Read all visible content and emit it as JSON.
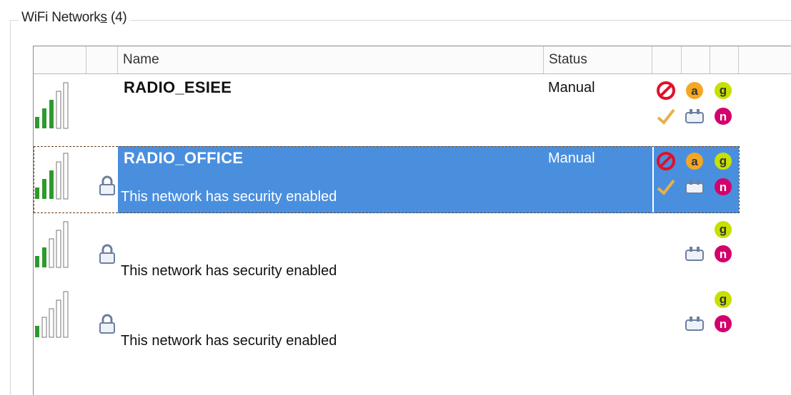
{
  "group": {
    "title_pre": "WiFi Network",
    "title_u": "s",
    "title_post": " (4)"
  },
  "columns": {
    "name": "Name",
    "status": "Status"
  },
  "networks": [
    {
      "name": "RADIO_ESIEE",
      "status": "Manual",
      "security": "",
      "signal_bars": 3,
      "locked": false,
      "selected": false,
      "icons": [
        "blocked-icon",
        "band-a-icon",
        "band-g-icon",
        "check-icon",
        "adapter-icon",
        "band-n-icon"
      ]
    },
    {
      "name": "RADIO_OFFICE",
      "status": "Manual",
      "security": "This network has security enabled",
      "signal_bars": 3,
      "locked": true,
      "selected": true,
      "icons": [
        "blocked-icon",
        "band-a-icon",
        "band-g-icon",
        "check-icon",
        "adapter-icon",
        "band-n-icon"
      ]
    },
    {
      "name": "",
      "status": "",
      "security": "This network has security enabled",
      "signal_bars": 2,
      "locked": true,
      "selected": false,
      "icons": [
        "band-g-icon",
        "adapter-icon",
        "band-n-icon"
      ]
    },
    {
      "name": "",
      "status": "",
      "security": "This network has security enabled",
      "signal_bars": 1,
      "locked": true,
      "selected": false,
      "icons": [
        "band-g-icon",
        "adapter-icon",
        "band-n-icon"
      ]
    }
  ],
  "colors": {
    "selection": "#4a8fde",
    "signal_on": "#2e9a2e",
    "band_a": "#f5a623",
    "band_g": "#c6e000",
    "band_n": "#d4006b",
    "blocked": "#e0102a"
  },
  "icon_text": {
    "a": "a",
    "g": "g",
    "n": "n"
  }
}
